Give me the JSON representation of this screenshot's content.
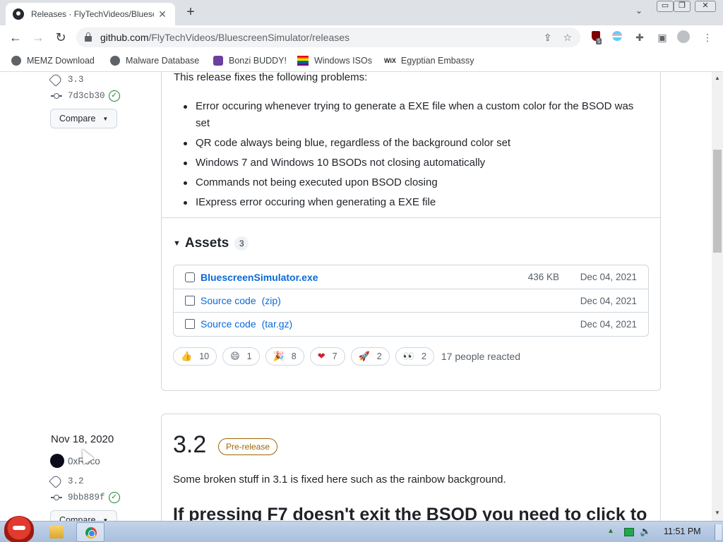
{
  "browser": {
    "tab_title": "Releases · FlyTechVideos/Bluesc",
    "tab_close": "✕",
    "new_tab": "+",
    "url_host": "github.com",
    "url_path": "/FlyTechVideos/BluescreenSimulator/releases",
    "extension_badge": "5",
    "window_controls": {
      "minimize": "▭",
      "restore": "❐",
      "close": "✕"
    },
    "bookmarks": [
      {
        "label": "MEMZ Download",
        "icon": "globe-icon"
      },
      {
        "label": "Malware Database",
        "icon": "globe-icon"
      },
      {
        "label": "Bonzi BUDDY!",
        "icon": "bonzi-icon"
      },
      {
        "label": "Windows ISOs",
        "icon": "rainbow-flag-icon"
      },
      {
        "label": "Egyptian Embassy",
        "icon": "wix-icon"
      }
    ]
  },
  "release_33": {
    "tag": "3.3",
    "commit": "7d3cb30",
    "compare_label": "Compare",
    "intro": "This release fixes the following problems:",
    "fixes": [
      "Error occuring whenever trying to generate a EXE file when a custom color for the BSOD was set",
      "QR code always being blue, regardless of the background color set",
      "Windows 7 and Windows 10 BSODs not closing automatically",
      "Commands not being executed upon BSOD closing",
      "IExpress error occuring when generating a EXE file"
    ],
    "assets_label": "Assets",
    "assets_count": "3",
    "assets": [
      {
        "name": "BluescreenSimulator.exe",
        "format": "",
        "size": "436 KB",
        "date": "Dec 04, 2021"
      },
      {
        "name": "Source code",
        "format": "(zip)",
        "size": "",
        "date": "Dec 04, 2021"
      },
      {
        "name": "Source code",
        "format": "(tar.gz)",
        "size": "",
        "date": "Dec 04, 2021"
      }
    ],
    "reactions": [
      {
        "emoji": "👍",
        "count": "10",
        "name": "thumbs-up"
      },
      {
        "emoji": "😄",
        "count": "1",
        "name": "laugh"
      },
      {
        "emoji": "🎉",
        "count": "8",
        "name": "hooray"
      },
      {
        "emoji": "❤",
        "count": "7",
        "name": "heart"
      },
      {
        "emoji": "🚀",
        "count": "2",
        "name": "rocket"
      },
      {
        "emoji": "👀",
        "count": "2",
        "name": "eyes"
      }
    ],
    "reacted_text": "17 people reacted"
  },
  "release_32": {
    "date": "Nov 18, 2020",
    "author": "0xRoco",
    "tag": "3.2",
    "commit": "9bb889f",
    "compare_label": "Compare",
    "title": "3.2",
    "badge": "Pre-release",
    "body": "Some broken stuff in 3.1 is fixed here such as the rainbow background.",
    "heading": "If pressing F7 doesn't exit the BSOD you need to click to"
  },
  "taskbar": {
    "time": "11:51 PM"
  }
}
